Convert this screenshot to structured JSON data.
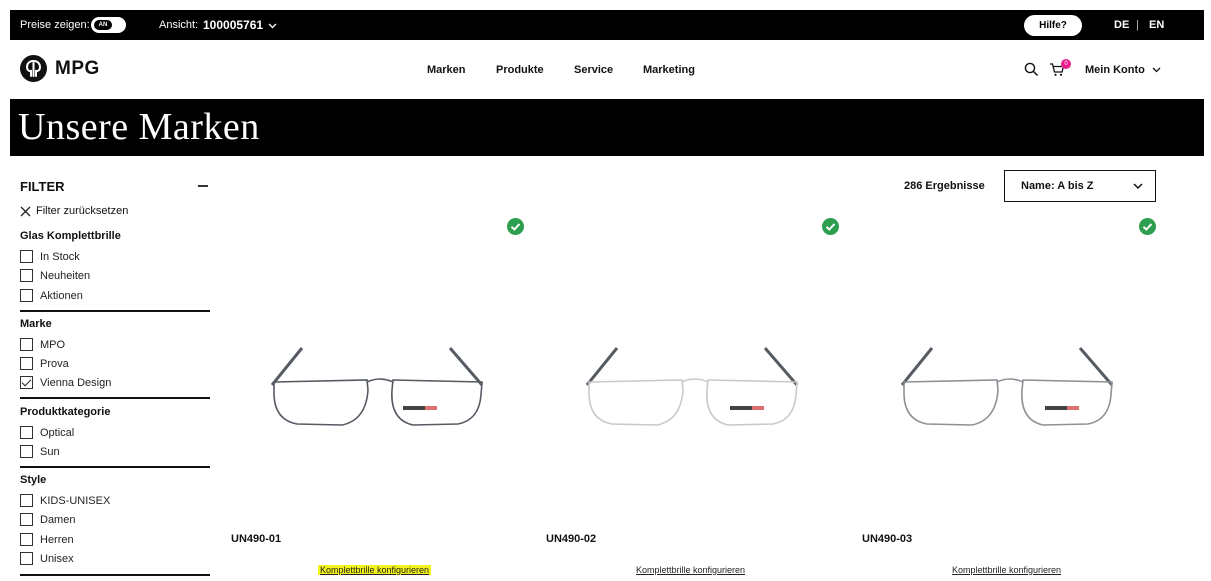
{
  "topbar": {
    "prices_label": "Preise zeigen:",
    "toggle_state": "AN",
    "view_label": "Ansicht:",
    "view_value": "100005761",
    "help": "Hilfe?",
    "lang_de": "DE",
    "lang_sep": "|",
    "lang_en": "EN"
  },
  "header": {
    "logo_text": "MPG",
    "nav": [
      "Marken",
      "Produkte",
      "Service",
      "Marketing"
    ],
    "cart_count": "0",
    "account": "Mein Konto"
  },
  "banner": {
    "title": "Unsere Marken"
  },
  "filter": {
    "title": "FILTER",
    "reset": "Filter zurücksetzen",
    "groups": [
      {
        "title": "Glas Komplettbrille",
        "options": [
          {
            "label": "In Stock",
            "checked": false
          },
          {
            "label": "Neuheiten",
            "checked": false
          },
          {
            "label": "Aktionen",
            "checked": false
          }
        ]
      },
      {
        "title": "Marke",
        "options": [
          {
            "label": "MPO",
            "checked": false
          },
          {
            "label": "Prova",
            "checked": false
          },
          {
            "label": "Vienna Design",
            "checked": true
          }
        ]
      },
      {
        "title": "Produktkategorie",
        "options": [
          {
            "label": "Optical",
            "checked": false
          },
          {
            "label": "Sun",
            "checked": false
          }
        ]
      },
      {
        "title": "Style",
        "options": [
          {
            "label": "KIDS-UNISEX",
            "checked": false
          },
          {
            "label": "Damen",
            "checked": false
          },
          {
            "label": "Herren",
            "checked": false
          },
          {
            "label": "Unisex",
            "checked": false
          }
        ]
      }
    ]
  },
  "results": {
    "count_text": "286 Ergebnisse",
    "sort_value": "Name: A bis Z"
  },
  "products": [
    {
      "code": "UN490-01",
      "cta": "Komplettbrille konfigurieren",
      "available": true,
      "frame_color": "#555b63",
      "highlighted": true
    },
    {
      "code": "UN490-02",
      "cta": "Komplettbrille konfigurieren",
      "available": true,
      "frame_color": "#c9c9c9",
      "highlighted": false
    },
    {
      "code": "UN490-03",
      "cta": "Komplettbrille konfigurieren",
      "available": true,
      "frame_color": "#8d9096",
      "highlighted": false
    }
  ],
  "colors": {
    "accent_green": "#2e9e4f",
    "badge_pink": "#e91e8c",
    "highlight_yellow": "#f4f41a"
  }
}
